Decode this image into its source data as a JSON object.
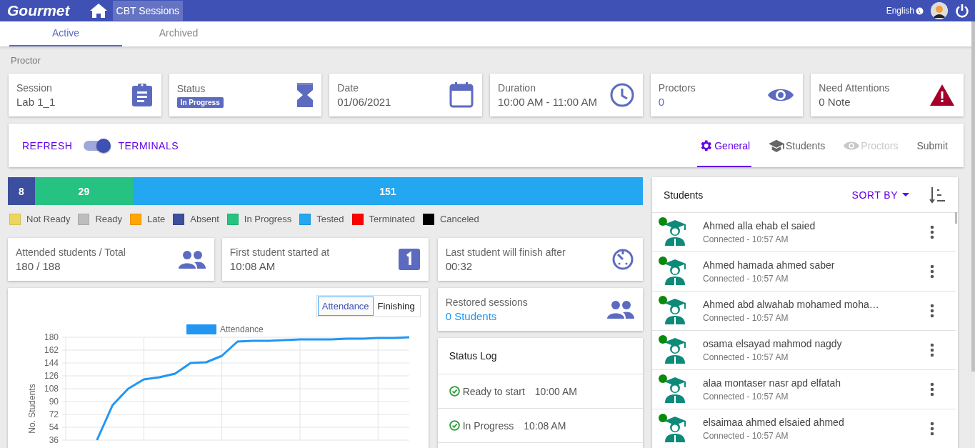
{
  "header": {
    "logo": "Gourmet",
    "breadcrumb": "CBT Sessions",
    "language": "English"
  },
  "tabs": [
    {
      "label": "Active",
      "selected": true
    },
    {
      "label": "Archived",
      "selected": false
    }
  ],
  "section_title": "Proctor",
  "info_cards": [
    {
      "label": "Session",
      "value": "Lab 1_1",
      "kind": "text"
    },
    {
      "label": "Status",
      "value": "In Progress",
      "kind": "badge"
    },
    {
      "label": "Date",
      "value": "01/06/2021",
      "kind": "text"
    },
    {
      "label": "Duration",
      "value": "10:00 AM - 11:00 AM",
      "kind": "text"
    },
    {
      "label": "Proctors",
      "value": "0",
      "kind": "link"
    },
    {
      "label": "Need Attentions",
      "value": "0 Note",
      "kind": "text"
    }
  ],
  "toolbar": {
    "refresh": "REFRESH",
    "toggle": {
      "label": "TERMINALS",
      "on": true
    },
    "nav": [
      {
        "label": "General",
        "kind": "tab",
        "selected": true,
        "disabled": false
      },
      {
        "label": "Students",
        "kind": "tab",
        "selected": false,
        "disabled": false
      },
      {
        "label": "Proctors",
        "kind": "tab",
        "selected": false,
        "disabled": true
      },
      {
        "label": "Submit",
        "kind": "button",
        "selected": false,
        "disabled": false
      }
    ]
  },
  "status_bar": [
    {
      "count": "8",
      "color": "#3b4f9e"
    },
    {
      "count": "29",
      "color": "#26c281"
    },
    {
      "count": "151",
      "color": "#22a7f0"
    }
  ],
  "legend": [
    {
      "label": "Not Ready",
      "color": "#edd55e"
    },
    {
      "label": "Ready",
      "color": "#bdbdbd"
    },
    {
      "label": "Late",
      "color": "#ffa500"
    },
    {
      "label": "Absent",
      "color": "#3b4f9e"
    },
    {
      "label": "In Progress",
      "color": "#26c281"
    },
    {
      "label": "Tested",
      "color": "#22a7f0"
    },
    {
      "label": "Terminated",
      "color": "#ff0000"
    },
    {
      "label": "Canceled",
      "color": "#000000"
    }
  ],
  "stat_cards": [
    {
      "label": "Attended students / Total",
      "value": "180 / 188",
      "kind": "text"
    },
    {
      "label": "First student started at",
      "value": "10:08 AM",
      "kind": "text"
    }
  ],
  "chart_panel": {
    "toggle": [
      {
        "label": "Attendance",
        "selected": true
      },
      {
        "label": "Finishing",
        "selected": false
      }
    ],
    "chart_data": {
      "type": "line",
      "ylabel": "No. Students",
      "categories": [
        null,
        null,
        null,
        null,
        null,
        null,
        null,
        null,
        null,
        null,
        null,
        null,
        null,
        null,
        null,
        null,
        null,
        null,
        null,
        null,
        null
      ],
      "grid": true,
      "ylim": [
        36,
        180
      ],
      "yticks": [
        36,
        54,
        72,
        90,
        108,
        126,
        144,
        162,
        180
      ],
      "series": [
        {
          "name": "Attendance",
          "color": "#2196f3",
          "values": [
            36,
            85,
            108,
            121,
            124,
            129,
            144,
            145,
            154,
            174,
            175,
            175,
            176,
            177,
            177,
            177,
            178,
            178,
            179,
            179,
            180
          ]
        }
      ]
    }
  },
  "middle_cards": [
    {
      "label": "Last student will finish after",
      "value": "00:32",
      "kind": "text"
    },
    {
      "label": "Restored sessions",
      "value": "0 Students",
      "kind": "link"
    }
  ],
  "status_log": {
    "title": "Status Log",
    "entries": [
      {
        "label": "Ready to start",
        "time": "10:00 AM"
      },
      {
        "label": "In Progress",
        "time": "10:08 AM"
      }
    ]
  },
  "students": {
    "title": "Students",
    "sort": "SORT BY",
    "items": [
      {
        "name": "Ahmed alla ehab el saied",
        "status": "Connected - 10:57 AM",
        "online": true
      },
      {
        "name": "Ahmed hamada ahmed saber",
        "status": "Connected - 10:57 AM",
        "online": true
      },
      {
        "name": "Ahmed abd alwahab mohamed moha…",
        "status": "Connected - 10:57 AM",
        "online": true
      },
      {
        "name": "osama elsayad mahmod nagdy",
        "status": "Connected - 10:57 AM",
        "online": true
      },
      {
        "name": "alaa montaser nasr apd elfatah",
        "status": "Connected - 10:57 AM",
        "online": true
      },
      {
        "name": "elsaimaa ahmed elsaied ahmed",
        "status": "Connected - 10:57 AM",
        "online": true
      }
    ]
  }
}
